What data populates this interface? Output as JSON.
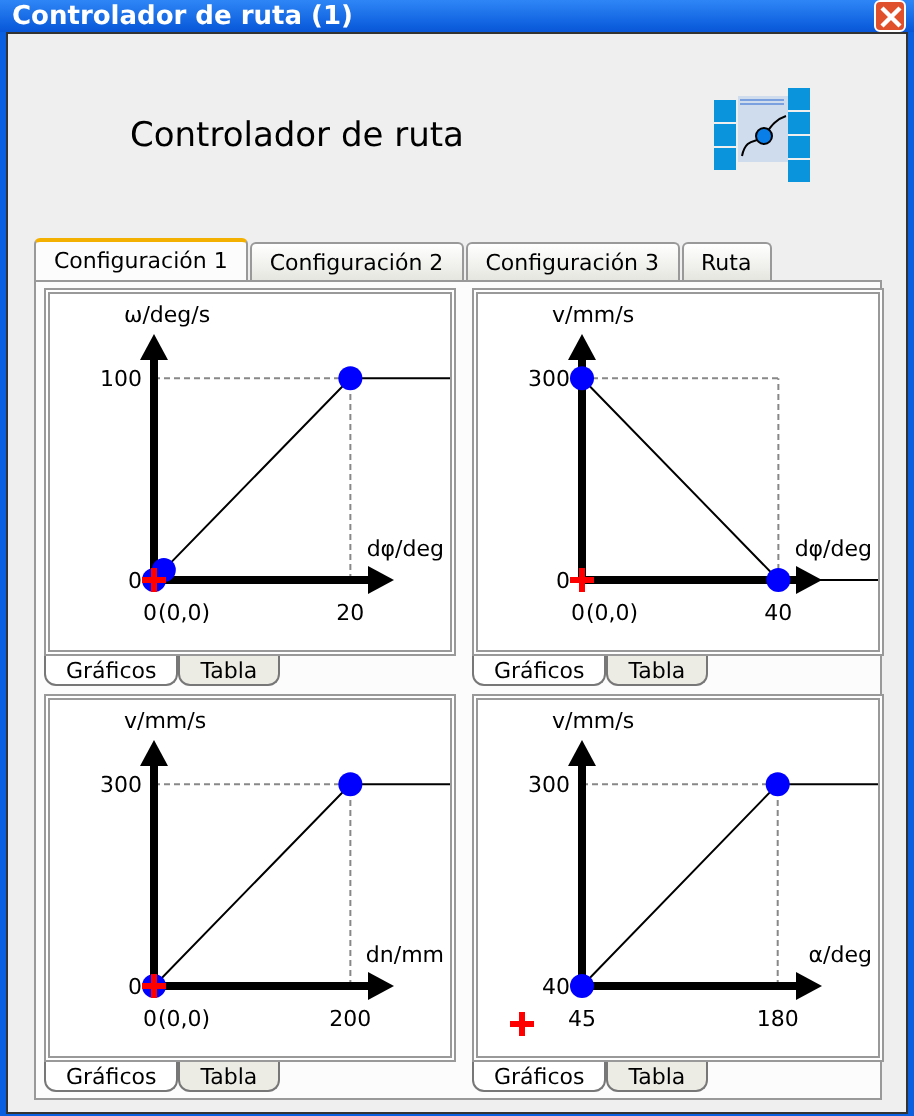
{
  "window": {
    "title": "Controlador de ruta (1)"
  },
  "header": {
    "title": "Controlador de ruta"
  },
  "tabs": [
    {
      "label": "Configuración 1",
      "selected": true
    },
    {
      "label": "Configuración 2",
      "selected": false
    },
    {
      "label": "Configuración 3",
      "selected": false
    },
    {
      "label": "Ruta",
      "selected": false
    }
  ],
  "panels": [
    {
      "reference": {
        "kind": "origin",
        "label": "(0,0)"
      },
      "subtabs": [
        {
          "label": "Gráficos",
          "selected": true
        },
        {
          "label": "Tabla",
          "selected": false
        }
      ],
      "chart_data": {
        "type": "line",
        "xlabel": "dφ/deg",
        "ylabel": "ω/deg/s",
        "x": [
          0,
          1,
          20
        ],
        "series": [
          {
            "color": "#0000ff",
            "marker": "circle",
            "values": [
              0,
              5,
              100
            ]
          }
        ],
        "xlim": [
          0,
          22
        ],
        "ylim": [
          0,
          110
        ],
        "xticks": [
          0,
          20
        ],
        "yticks": [
          0,
          100
        ],
        "ref_lines": [
          {
            "axis": "x",
            "value": 20
          },
          {
            "axis": "y",
            "value": 100
          }
        ]
      }
    },
    {
      "reference": {
        "kind": "origin",
        "label": "(0,0)"
      },
      "subtabs": [
        {
          "label": "Gráficos",
          "selected": true
        },
        {
          "label": "Tabla",
          "selected": false
        }
      ],
      "chart_data": {
        "type": "line",
        "xlabel": "dφ/deg",
        "ylabel": "v/mm/s",
        "x": [
          0,
          40
        ],
        "series": [
          {
            "color": "#0000ff",
            "marker": "circle",
            "values": [
              300,
              0
            ]
          }
        ],
        "xlim": [
          0,
          44
        ],
        "ylim": [
          0,
          330
        ],
        "xticks": [
          0,
          40
        ],
        "yticks": [
          0,
          300
        ],
        "ref_lines": [
          {
            "axis": "x",
            "value": 40
          },
          {
            "axis": "y",
            "value": 300
          }
        ]
      }
    },
    {
      "reference": {
        "kind": "origin",
        "label": "(0,0)"
      },
      "subtabs": [
        {
          "label": "Gráficos",
          "selected": true
        },
        {
          "label": "Tabla",
          "selected": false
        }
      ],
      "chart_data": {
        "type": "line",
        "xlabel": "dn/mm",
        "ylabel": "v/mm/s",
        "x": [
          0,
          200
        ],
        "series": [
          {
            "color": "#0000ff",
            "marker": "circle",
            "values": [
              0,
              300
            ]
          }
        ],
        "xlim": [
          0,
          220
        ],
        "ylim": [
          0,
          330
        ],
        "xticks": [
          0,
          200
        ],
        "yticks": [
          0,
          300
        ],
        "ref_lines": [
          {
            "axis": "x",
            "value": 200
          },
          {
            "axis": "y",
            "value": 300
          }
        ]
      }
    },
    {
      "reference": {
        "kind": "outside"
      },
      "subtabs": [
        {
          "label": "Gráficos",
          "selected": true
        },
        {
          "label": "Tabla",
          "selected": false
        }
      ],
      "chart_data": {
        "type": "line",
        "xlabel": "α/deg",
        "ylabel": "v/mm/s",
        "x": [
          45,
          180
        ],
        "series": [
          {
            "color": "#0000ff",
            "marker": "circle",
            "values": [
              40,
              300
            ]
          }
        ],
        "xlim": [
          45,
          194
        ],
        "ylim": [
          40,
          326
        ],
        "xticks": [
          45,
          180
        ],
        "yticks": [
          40,
          300
        ],
        "ref_lines": [
          {
            "axis": "x",
            "value": 180
          },
          {
            "axis": "y",
            "value": 300
          }
        ]
      }
    }
  ]
}
